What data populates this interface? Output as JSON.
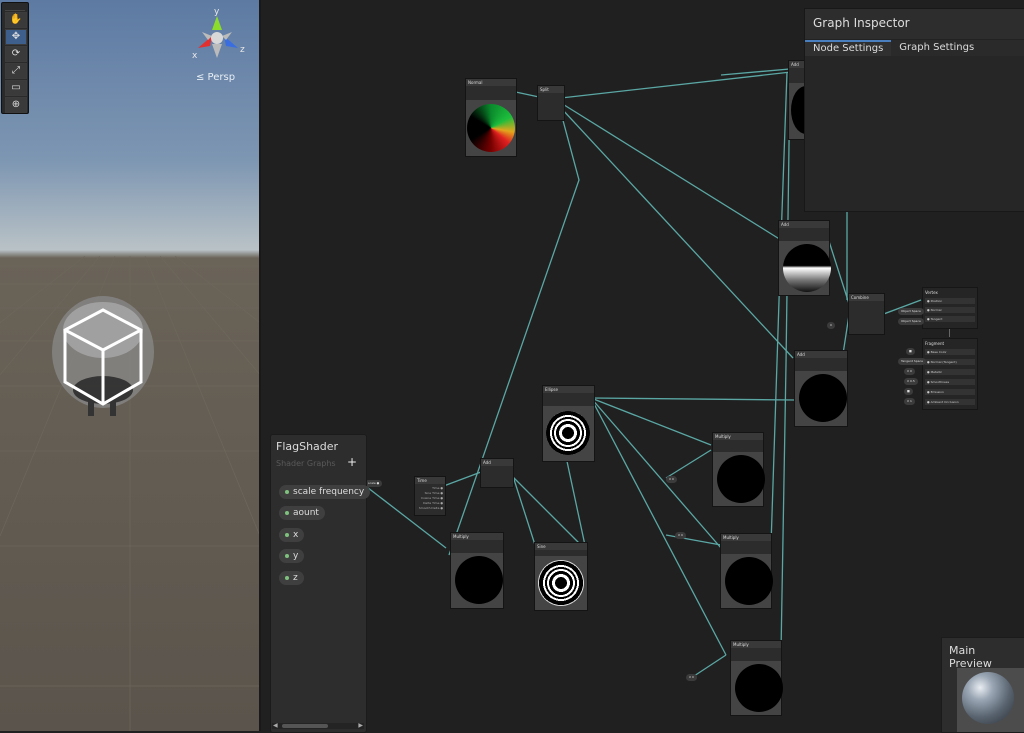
{
  "scene_view": {
    "tools": [
      "hand-tool",
      "move-tool",
      "rotate-tool",
      "scale-tool",
      "rect-tool",
      "transform-tool"
    ],
    "tool_glyphs": [
      "✋",
      "✥",
      "⟳",
      "⤢",
      "▭",
      "⊕"
    ],
    "gizmo": {
      "x_label": "x",
      "y_label": "y",
      "z_label": "z"
    },
    "camera_mode": "≤ Persp"
  },
  "graph_inspector": {
    "title": "Graph Inspector",
    "tabs": [
      "Node Settings",
      "Graph Settings"
    ],
    "active_tab": "Node Settings"
  },
  "blackboard": {
    "title": "FlagShader",
    "subtitle": "Shader Graphs",
    "add_label": "+",
    "properties": [
      "scale frequency",
      "aount",
      "x",
      "y",
      "z"
    ]
  },
  "main_preview": {
    "title": "Main Preview"
  },
  "nodes": {
    "normal": "Normal",
    "split": "Split",
    "add": "Add",
    "combine": "Combine",
    "ellipse": "Ellipse",
    "time": "Time",
    "sine": "Sine",
    "multiply": "Multiply",
    "vertex": "Vertex",
    "fragment": "Fragment"
  },
  "colors": {
    "wire": "#5aa7a4",
    "accent": "#4a7fbf",
    "property_dot": "#7fc27f"
  }
}
